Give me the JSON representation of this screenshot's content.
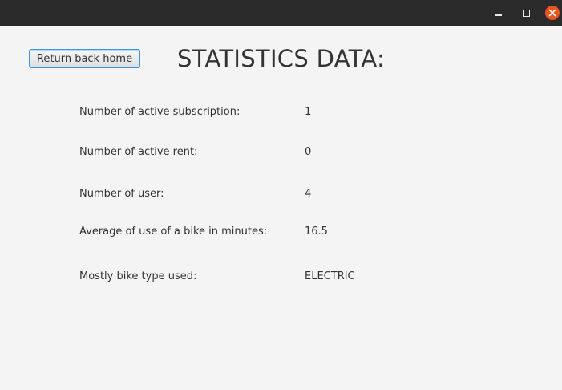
{
  "window": {
    "controls": {
      "minimize_icon": "minimize-icon",
      "maximize_icon": "maximize-icon",
      "close_icon": "close-icon",
      "close_color": "#e95420"
    }
  },
  "toolbar": {
    "home_label": "Return back home"
  },
  "page": {
    "title": "STATISTICS DATA:"
  },
  "stats": [
    {
      "label": "Number of active subscription:",
      "value": "1"
    },
    {
      "label": "Number of active rent:",
      "value": "0"
    },
    {
      "label": "Number of user:",
      "value": "4"
    },
    {
      "label": "Average of use of a bike in minutes:",
      "value": "16.5"
    },
    {
      "label": "Mostly bike type used:",
      "value": "ELECTRIC"
    }
  ]
}
